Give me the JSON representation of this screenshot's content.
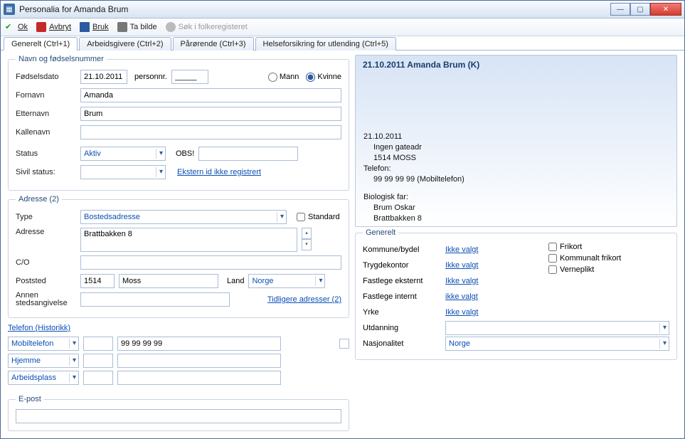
{
  "window": {
    "title": "Personalia for Amanda Brum"
  },
  "toolbar": {
    "ok": "Ok",
    "avbryt": "Avbryt",
    "bruk": "Bruk",
    "ta_bilde": "Ta bilde",
    "sok": "Søk i folkeregisteret"
  },
  "tabs": {
    "generelt": "Generelt (Ctrl+1)",
    "arbeidsgivere": "Arbeidsgivere (Ctrl+2)",
    "parorende": "Pårørende (Ctrl+3)",
    "helseforsikring": "Helseforsikring for utlending (Ctrl+5)"
  },
  "navn": {
    "legend": "Navn og fødselsnummer",
    "fodselsdato_lbl": "Fødselsdato",
    "fodselsdato": "21.10.2011",
    "personnr_lbl": "personnr.",
    "personnr": "_____",
    "mann": "Mann",
    "kvinne": "Kvinne",
    "fornavn_lbl": "Fornavn",
    "fornavn": "Amanda",
    "etternavn_lbl": "Etternavn",
    "etternavn": "Brum",
    "kallenavn_lbl": "Kallenavn",
    "kallenavn": "",
    "status_lbl": "Status",
    "status": "Aktiv",
    "obs_lbl": "OBS!",
    "obs": "",
    "sivil_lbl": "Sivil status:",
    "sivil": "",
    "ekstern_link": "Ekstern id ikke registrert"
  },
  "adresse": {
    "legend": "Adresse (2)",
    "type_lbl": "Type",
    "type": "Bostedsadresse",
    "standard_lbl": "Standard",
    "adresse_lbl": "Adresse",
    "adresse": "Brattbakken 8",
    "co_lbl": "C/O",
    "co": "",
    "poststed_lbl": "Poststed",
    "postnr": "1514",
    "poststed": "Moss",
    "land_lbl": "Land",
    "land": "Norge",
    "annen_lbl": "Annen stedsangivelse",
    "annen": "",
    "tidligere_link": "Tidligere adresser (2)"
  },
  "telefon": {
    "link": "Telefon (Historikk)",
    "rows": [
      {
        "type": "Mobiltelefon",
        "num": "99 99 99 99"
      },
      {
        "type": "Hjemme",
        "num": ""
      },
      {
        "type": "Arbeidsplass",
        "num": ""
      }
    ]
  },
  "epost": {
    "legend": "E-post",
    "value": ""
  },
  "summary": {
    "title": "21.10.2011 Amanda Brum (K)",
    "dob": "21.10.2011",
    "gate": "Ingen gateadr",
    "post": "1514 MOSS",
    "tel_lbl": "Telefon:",
    "tel": "99 99 99 99 (Mobiltelefon)",
    "biofar_lbl": "Biologisk far:",
    "biofar_name": "Brum Oskar",
    "biofar_addr": "Brattbakken 8"
  },
  "generelt": {
    "legend": "Generelt",
    "kommune_lbl": "Kommune/bydel",
    "kommune": "Ikke valgt",
    "trygde_lbl": "Trygdekontor",
    "trygde": "Ikke valgt",
    "fastE_lbl": "Fastlege eksternt",
    "fastE": "Ikke valgt",
    "fastI_lbl": "Fastlege internt",
    "fastI": "ikke valgt",
    "yrke_lbl": "Yrke",
    "yrke": "Ikke valgt",
    "utdan_lbl": "Utdanning",
    "utdan": "",
    "nasj_lbl": "Nasjonalitet",
    "nasj": "Norge",
    "frikort": "Frikort",
    "komm_frikort": "Kommunalt frikort",
    "verneplikt": "Verneplikt"
  }
}
